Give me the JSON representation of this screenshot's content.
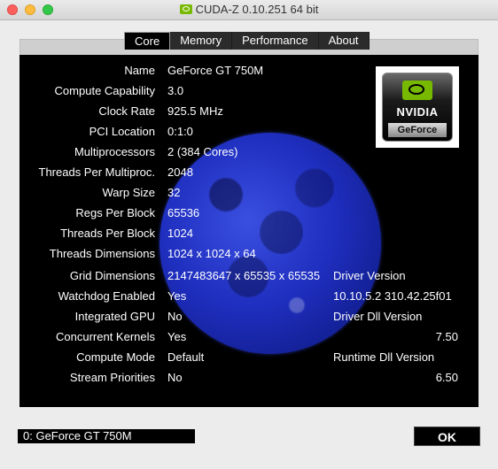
{
  "window": {
    "title": "CUDA-Z 0.10.251 64 bit"
  },
  "tabs": [
    {
      "label": "Core",
      "active": true
    },
    {
      "label": "Memory"
    },
    {
      "label": "Performance"
    },
    {
      "label": "About"
    }
  ],
  "core": {
    "rows": [
      {
        "label": "Name",
        "value": "GeForce GT 750M"
      },
      {
        "label": "Compute Capability",
        "value": "3.0"
      },
      {
        "label": "Clock Rate",
        "value": "925.5 MHz"
      },
      {
        "label": "PCI Location",
        "value": "0:1:0"
      },
      {
        "label": "Multiprocessors",
        "value": "2 (384 Cores)"
      },
      {
        "label": "Threads Per Multiproc.",
        "value": "2048"
      },
      {
        "label": "Warp Size",
        "value": "32"
      },
      {
        "label": "Regs Per Block",
        "value": "65536"
      },
      {
        "label": "Threads Per Block",
        "value": "1024"
      },
      {
        "label": "Threads Dimensions",
        "value": "1024 x 1024 x 64"
      },
      {
        "label": "Grid Dimensions",
        "value": "2147483647 x 65535 x 65535"
      },
      {
        "label": "Watchdog Enabled",
        "value": "Yes"
      },
      {
        "label": "Integrated GPU",
        "value": "No"
      },
      {
        "label": "Concurrent Kernels",
        "value": "Yes"
      },
      {
        "label": "Compute Mode",
        "value": "Default"
      },
      {
        "label": "Stream Priorities",
        "value": "No"
      }
    ],
    "driver_version_label": "Driver Version",
    "driver_version": "10.10.5.2 310.42.25f01",
    "driver_dll_label": "Driver Dll Version",
    "driver_dll": "7.50",
    "runtime_dll_label": "Runtime Dll Version",
    "runtime_dll": "6.50"
  },
  "logo": {
    "brand": "NVIDIA",
    "product": "GeForce"
  },
  "footer": {
    "device": "0: GeForce GT 750M",
    "ok_label": "OK"
  },
  "colors": {
    "nvidia_green": "#76b900",
    "moon_blue": "#2a3dd8"
  }
}
